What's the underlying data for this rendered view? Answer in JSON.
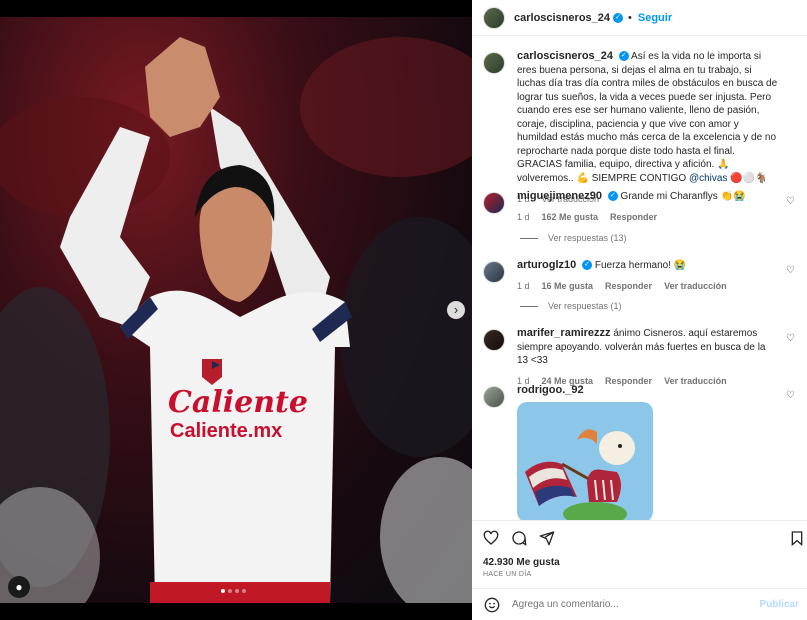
{
  "header": {
    "username": "carloscisneros_24",
    "separator": "•",
    "follow_label": "Seguir"
  },
  "caption": {
    "username": "carloscisneros_24",
    "text": "Así es la vida no le importa si eres buena persona, si dejas el alma en tu trabajo, si luchas día tras día contra miles de obstáculos en busca de lograr tus sueños, la vida a veces puede ser injusta. Pero cuando eres ese ser humano valiente, lleno de pasión, coraje, disciplina, paciencia y que vive con amor y humildad estás mucho más cerca de la excelencia y de no reprocharte nada porque diste todo hasta el final. GRACIAS familia, equipo, directiva y afición. 🙏 volveremos.. 💪 SIEMPRE CONTIGO",
    "mention": "@chivas",
    "emojis": "🔴⚪🐐",
    "time": "1 d",
    "translate": "Ver traducción"
  },
  "comments": [
    {
      "username": "miguejimenez90",
      "verified": true,
      "text": "Grande mi Charanflys 👏😭",
      "time": "1 d",
      "likes": "162 Me gusta",
      "reply": "Responder",
      "translate": "",
      "replies": "Ver respuestas (13)"
    },
    {
      "username": "arturoglz10",
      "verified": true,
      "text": "Fuerza hermano! 😭",
      "time": "1 d",
      "likes": "16 Me gusta",
      "reply": "Responder",
      "translate": "Ver traducción",
      "replies": "Ver respuestas (1)"
    },
    {
      "username": "marifer_ramirezzz",
      "verified": false,
      "text": "ánimo Cisneros. aquí estaremos siempre apoyando. volverán más fuertes en busca de la 13 <33",
      "time": "1 d",
      "likes": "24 Me gusta",
      "reply": "Responder",
      "translate": "Ver traducción",
      "replies": ""
    },
    {
      "username": "rodrigoo._92",
      "verified": false,
      "text": "",
      "time": "",
      "likes": "",
      "reply": "",
      "translate": "",
      "replies": ""
    }
  ],
  "stats": {
    "likes": "42.930 Me gusta",
    "when": "HACE UN DÍA"
  },
  "add_comment": {
    "placeholder": "Agrega un comentario...",
    "post_label": "Publicar"
  },
  "jersey": {
    "sponsor_top": "Caliente",
    "sponsor_bottom": "Caliente.mx"
  },
  "icons": [
    "heart-icon",
    "comment-icon",
    "share-icon",
    "bookmark-icon",
    "emoji-icon",
    "chevron-right-icon",
    "user-tag-icon",
    "verified-icon"
  ],
  "colors": {
    "accent": "#0095f6",
    "mention": "#00376b",
    "muted": "#737373"
  }
}
